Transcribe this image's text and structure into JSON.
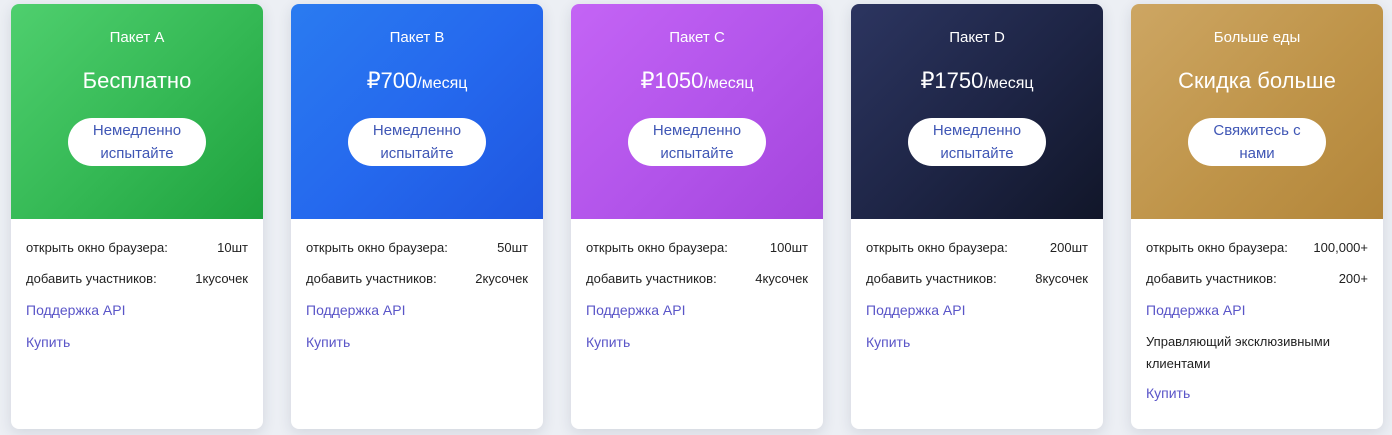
{
  "plans": [
    {
      "name": "Пакет A",
      "price": "Бесплатно",
      "unit": "",
      "cta": "Немедленно испытайте",
      "browser_label": "открыть окно браузера:",
      "browser_value": "10шт",
      "members_label": "добавить участников:",
      "members_value": "1кусочек",
      "api_label": "Поддержка API",
      "extra": "",
      "buy_label": "Купить",
      "color": "#34b854"
    },
    {
      "name": "Пакет B",
      "price": "₽700",
      "unit": "/месяц",
      "cta": "Немедленно испытайте",
      "browser_label": "открыть окно браузера:",
      "browser_value": "50шт",
      "members_label": "добавить участников:",
      "members_value": "2кусочек",
      "api_label": "Поддержка API",
      "extra": "",
      "buy_label": "Купить",
      "color": "#2569ee"
    },
    {
      "name": "Пакет C",
      "price": "₽1050",
      "unit": "/месяц",
      "cta": "Немедленно испытайте",
      "browser_label": "открыть окно браузера:",
      "browser_value": "100шт",
      "members_label": "добавить участников:",
      "members_value": "4кусочек",
      "api_label": "Поддержка API",
      "extra": "",
      "buy_label": "Купить",
      "color": "#b254ea"
    },
    {
      "name": "Пакет D",
      "price": "₽1750",
      "unit": "/месяц",
      "cta": "Немедленно испытайте",
      "browser_label": "открыть окно браузера:",
      "browser_value": "200шт",
      "members_label": "добавить участников:",
      "members_value": "8кусочек",
      "api_label": "Поддержка API",
      "extra": "",
      "buy_label": "Купить",
      "color": "#1d2444"
    },
    {
      "name": "Больше еды",
      "price": "Скидка больше",
      "unit": "",
      "cta": "Свяжитесь с нами",
      "browser_label": "открыть окно браузера:",
      "browser_value": "100,000+",
      "members_label": "добавить участников:",
      "members_value": "200+",
      "api_label": "Поддержка API",
      "extra": "Управляющий эксклюзивными клиентами",
      "buy_label": "Купить",
      "color": "#bf9449"
    }
  ],
  "link_color": "#5a55c8",
  "button_text_color": "#3f56b5"
}
